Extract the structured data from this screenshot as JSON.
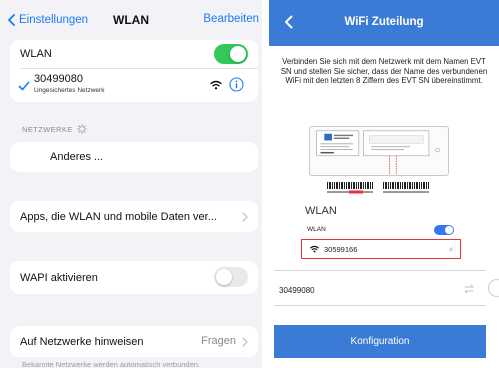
{
  "left": {
    "nav": {
      "back_label": "Einstellungen",
      "title": "WLAN",
      "edit_label": "Bearbeiten"
    },
    "wlan_row": {
      "label": "WLAN",
      "enabled": true
    },
    "current_network": {
      "name": "30499080",
      "subtitle": "Ungesichertes Netzwerk"
    },
    "networks_section": {
      "label": "NETZWERKE"
    },
    "other_network": {
      "label": "Anderes ..."
    },
    "apps_row": {
      "label": "Apps, die WLAN und mobile Daten ver..."
    },
    "wapi_row": {
      "label": "WAPI aktivieren",
      "enabled": false
    },
    "ask_join_row": {
      "label": "Auf Netzwerke hinweisen",
      "value": "Fragen"
    },
    "footnote": "Bekannte Netzwerke werden automatisch verbunden.",
    "colors": {
      "accent": "#1a7cf5",
      "toggle_on": "#34c759",
      "background": "#f2f2f7"
    }
  },
  "right": {
    "header": {
      "title": "WiFi Zuteilung"
    },
    "instruction": "Verbinden Sie sich mit dem Netzwerk mit dem Namen EVT SN und stellen Sie sicher, dass der Name des verbundenen WiFi mit den letzten 8 Ziffern des EVT SN übereinstimmt.",
    "illustration": {
      "wlan_title": "WLAN",
      "wlan_label": "WLAN",
      "network_name": "30599166"
    },
    "ssid_input": {
      "value": "30499080"
    },
    "button_label": "Konfiguration",
    "colors": {
      "header": "#3b7bd8",
      "highlight": "#e5323b"
    }
  }
}
